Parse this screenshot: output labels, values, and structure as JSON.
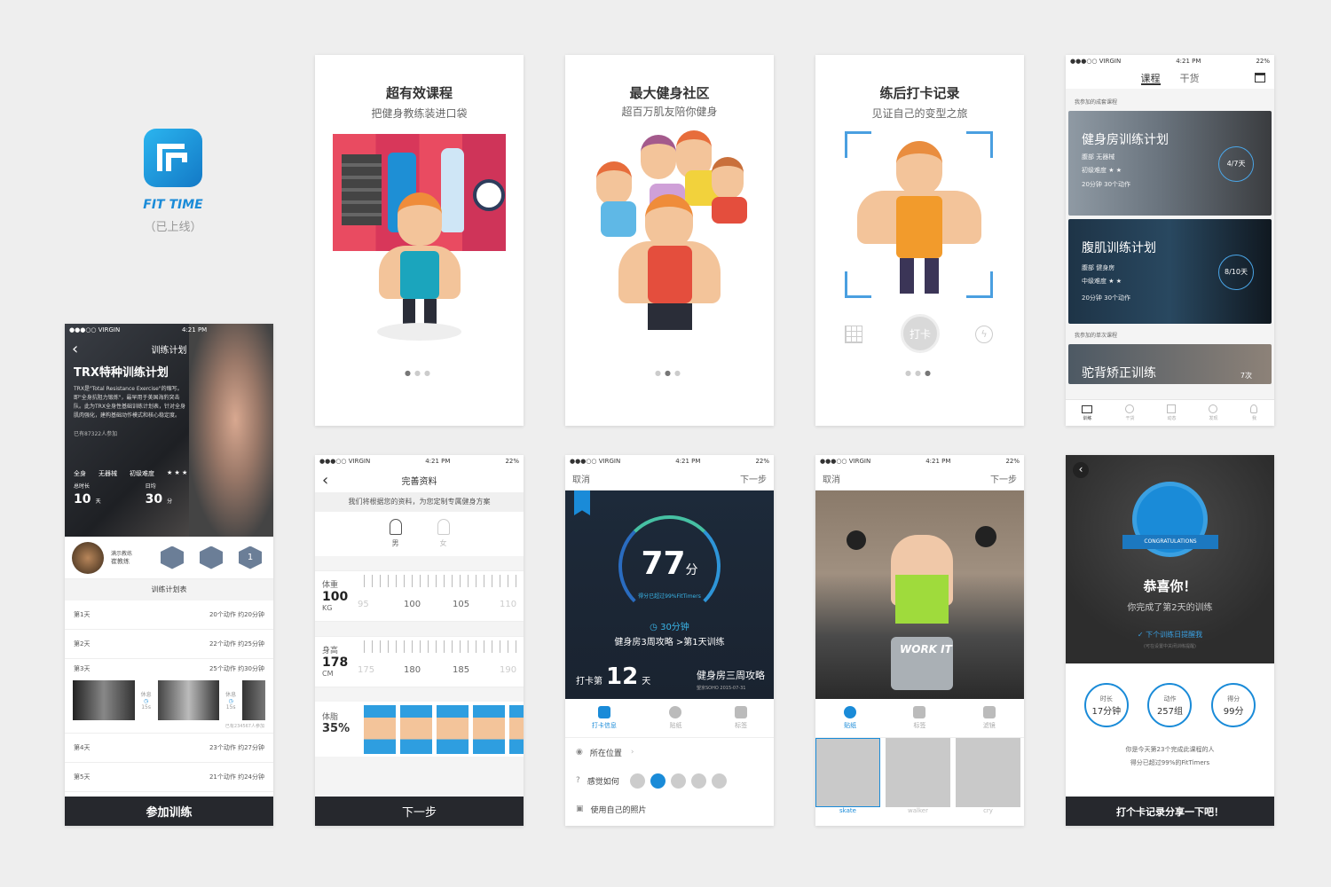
{
  "brand": {
    "name": "FIT TIME",
    "status": "（已上线）"
  },
  "colors": {
    "accent": "#1a8bd8",
    "dark": "#26282d",
    "brand_gradient_start": "#2bb5ef",
    "brand_gradient_end": "#1379c6"
  },
  "status_bar": {
    "carrier": "●●●○○ VIRGIN",
    "time": "4:21 PM",
    "battery": "22%"
  },
  "plan": {
    "back": "‹",
    "header": "训练计划",
    "title": "TRX特种训练计划",
    "desc": "TRX是\"Total Resistance Exercise\"的缩写。即\"全身抗阻力锻炼\"，最早用于美国海豹突击队。此为TRX全身性基础训练计划表，针对全身肌肉强化，建构基础动作模式和核心稳定度。",
    "joined": "已有87322人参加",
    "tags": [
      "全身",
      "无器械",
      "初级难度"
    ],
    "duration_label": "总时长",
    "duration": "10",
    "duration_unit": "天",
    "daily_label": "日均",
    "daily": "30",
    "daily_unit": "分",
    "coach_role": "满示教练",
    "coach_name": "崔教练",
    "badge_3": "1",
    "schedule_title": "训练计划表",
    "days": [
      {
        "day": "第1天",
        "info": "20个动作  约20分钟"
      },
      {
        "day": "第2天",
        "info": "22个动作  约25分钟"
      },
      {
        "day": "第3天",
        "info": "25个动作  约30分钟"
      }
    ],
    "rest1": "休息",
    "rest1_val": "15s",
    "rest2": "休息",
    "rest2_val": "15s",
    "done_count": "已有234567人参加",
    "days2": [
      {
        "day": "第4天",
        "info": "23个动作  约27分钟"
      },
      {
        "day": "第5天",
        "info": "21个动作  约24分钟"
      }
    ],
    "cta": "参加训练"
  },
  "onboard": [
    {
      "title": "超有效课程",
      "sub": "把健身教练装进口袋"
    },
    {
      "title": "最大健身社区",
      "sub": "超百万肌友陪你健身"
    },
    {
      "title": "练后打卡记录",
      "sub": "见证自己的变型之旅",
      "checkin": "打卡"
    }
  ],
  "courses": {
    "tab1": "课程",
    "tab2": "干货",
    "sec1": "我参加的成套课程",
    "cards": [
      {
        "title": "健身房训练计划",
        "r1": "腹部      无器械",
        "r2": "初级难度  ★ ★",
        "r3": "20分钟  30个动作",
        "progress": "4/7天"
      },
      {
        "title": "腹肌训练计划",
        "r1": "腹部      健身房",
        "r2": "中级难度  ★ ★",
        "r3": "20分钟  30个动作",
        "progress": "8/10天"
      }
    ],
    "sec2": "我参加的单次课程",
    "single": "驼背矫正训练",
    "single_progress": "7次",
    "nav": [
      "训练",
      "干货",
      "动态",
      "发现",
      "我"
    ]
  },
  "profile": {
    "back": "‹",
    "title": "完善资料",
    "hint": "我们将根据您的资料，为您定制专属健身方案",
    "male": "男",
    "female": "女",
    "weight_label": "体重",
    "weight": "100",
    "weight_unit": "KG",
    "weight_ticks": [
      "95",
      "100",
      "105",
      "110"
    ],
    "height_label": "身高",
    "height": "178",
    "height_unit": "CM",
    "height_ticks": [
      "175",
      "180",
      "185",
      "190"
    ],
    "fat_label": "体脂",
    "fat": "35%",
    "next": "下一步"
  },
  "score": {
    "cancel": "取消",
    "next": "下一步",
    "score": "77",
    "unit": "分",
    "beat": "得分已超过99%FitTimers",
    "time": "30分钟",
    "course": "健身房3周攻略 >第1天训练",
    "check_prefix": "打卡第",
    "check_day": "12",
    "check_unit": "天",
    "plan_name": "健身房三周攻略",
    "location": "望京SOHO",
    "date": "2015-07-31",
    "tabs": [
      "打卡信息",
      "贴纸",
      "标签"
    ],
    "loc_label": "所在位置",
    "feel_label": "感觉如何",
    "photo_label": "使用自己的照片"
  },
  "sticker": {
    "cancel": "取消",
    "next": "下一步",
    "workout_text": "WORK IT",
    "tabs": [
      "贴纸",
      "标签",
      "滤镜"
    ],
    "items": [
      "skate",
      "walker",
      "cry"
    ]
  },
  "congrats": {
    "back": "‹",
    "ribbon": "CONGRATULATIONS",
    "title": "恭喜你！",
    "sub": "你完成了第2天的训练",
    "remind": "下个训练日提醒我",
    "remind_hint": "(可在设置中关闭训练提醒)",
    "stats": [
      {
        "label": "时长",
        "value": "17分钟"
      },
      {
        "label": "动作",
        "value": "257组"
      },
      {
        "label": "得分",
        "value": "99分"
      }
    ],
    "rank1": "你是今天第23个完成此课程的人",
    "rank2": "得分已超过99%的FitTimers",
    "share": "打个卡记录分享一下吧！"
  }
}
